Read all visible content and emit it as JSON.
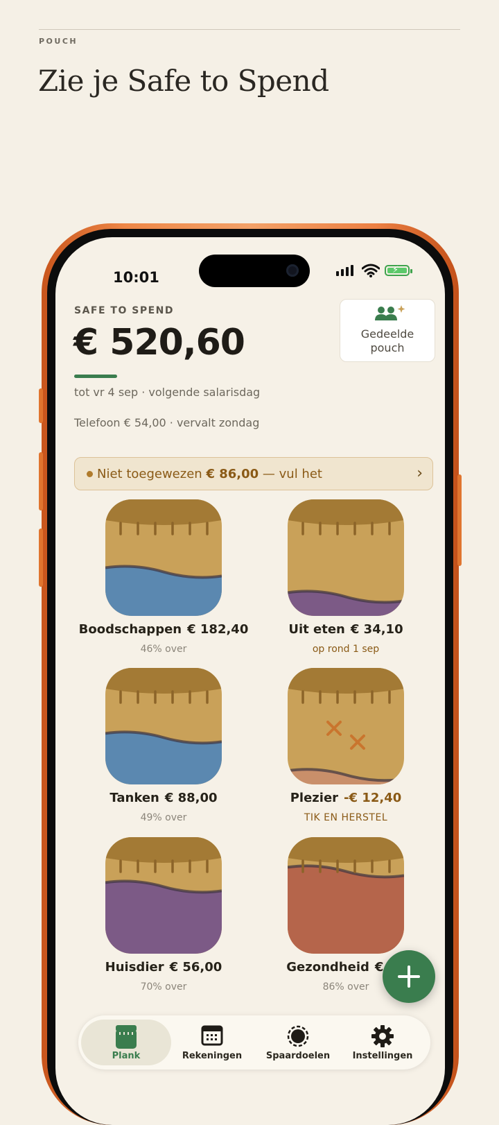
{
  "page": {
    "kicker": "POUCH",
    "headline": "Zie je Safe to Spend"
  },
  "status_bar": {
    "time": "10:01"
  },
  "summary": {
    "label": "SAFE TO SPEND",
    "amount": "€ 520,60",
    "until_line": "tot vr 4 sep · volgende salarisdag",
    "bill_line": "Telefoon € 54,00 · vervalt zondag"
  },
  "shared_pouch": {
    "label_line1": "Gedeelde",
    "label_line2": "pouch"
  },
  "banner": {
    "prefix": "Niet toegewezen",
    "amount": "€ 86,00",
    "suffix": "— vul het"
  },
  "pouches": [
    {
      "name": "Boodschappen",
      "amount": "€ 182,40",
      "sub": "46% over",
      "fill_color": "#5b88b0",
      "fill_level": 0.46
    },
    {
      "name": "Uit eten",
      "amount": "€ 34,10",
      "sub": "op rond 1 sep",
      "fill_color": "#7c5a86",
      "fill_level": 0.2
    },
    {
      "name": "Tanken",
      "amount": "€ 88,00",
      "sub": "49% over",
      "fill_color": "#5b88b0",
      "fill_level": 0.49
    },
    {
      "name": "Plezier",
      "amount": "-€ 12,40",
      "sub": "TIK EN HERSTEL",
      "fill_color": "#c98f6a",
      "fill_level": 0.1
    },
    {
      "name": "Huisdier",
      "amount": "€ 56,00",
      "sub": "70% over",
      "fill_color": "#7c5a86",
      "fill_level": 0.7
    },
    {
      "name": "Gezondheid",
      "amount": "€ 12",
      "sub": "86% over",
      "fill_color": "#b5654b",
      "fill_level": 0.86
    }
  ],
  "tabs": [
    {
      "label": "Plank",
      "icon": "jar-icon",
      "active": true
    },
    {
      "label": "Rekeningen",
      "icon": "calendar-icon",
      "active": false
    },
    {
      "label": "Spaardoelen",
      "icon": "target-icon",
      "active": false
    },
    {
      "label": "Instellingen",
      "icon": "gear-icon",
      "active": false
    }
  ],
  "colors": {
    "accent_green": "#3a7d4e",
    "pouch_lid": "#a37a35",
    "pouch_body": "#c9a159",
    "warning": "#8a5a16"
  }
}
